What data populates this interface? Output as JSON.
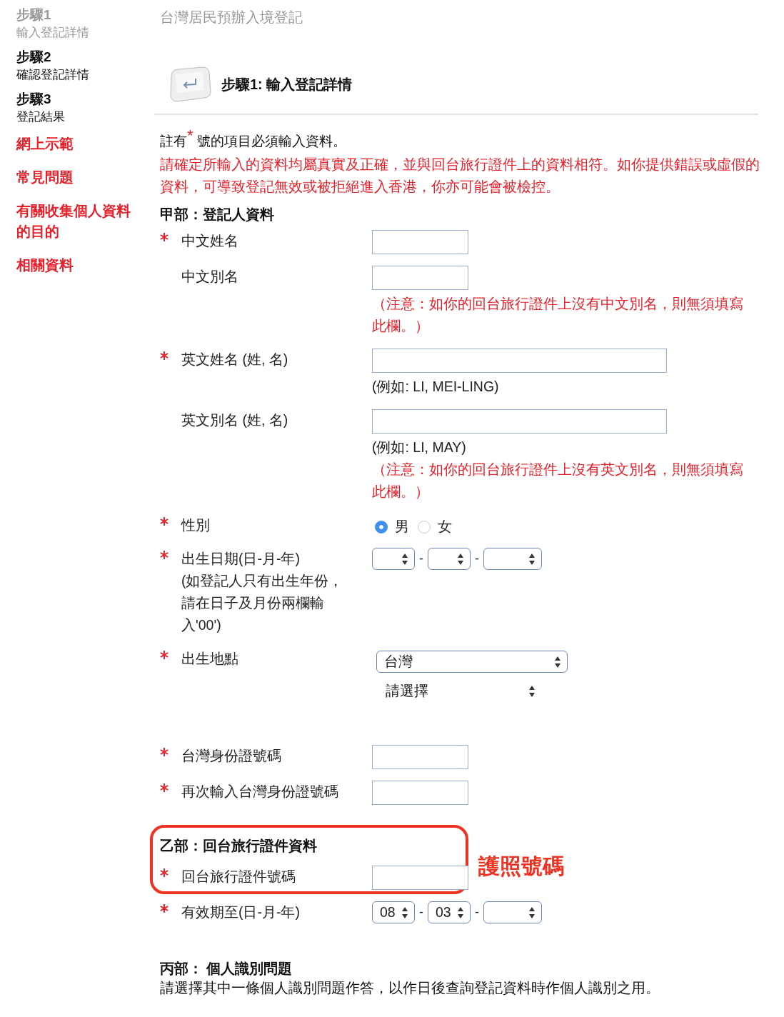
{
  "sidebar": {
    "steps": [
      {
        "step": "步驟1",
        "label": "輸入登記詳情",
        "disabled": true
      },
      {
        "step": "步驟2",
        "label": "確認登記詳情",
        "disabled": false
      },
      {
        "step": "步驟3",
        "label": "登記結果",
        "disabled": false
      }
    ],
    "links": [
      "網上示範",
      "常見問題",
      "有關收集個人資料的目的",
      "相關資料"
    ]
  },
  "page_title": "台灣居民預辦入境登記",
  "step_heading": "步驟1: 輸入登記詳情",
  "required_note": "註有$^{*}$ 號的項目必須輸入資料。",
  "warning": "請確定所輸入的資料均屬真實及正確，並與回台旅行證件上的資料相符。如你提供錯誤或虛假的資料，可導致登記無效或被拒絕進入香港，你亦可能會被檢控。",
  "sections": [
    {
      "heading": "甲部：登記人資料",
      "fields": [
        {
          "kind": "text",
          "label": "中文姓名",
          "required": true,
          "wide": false
        },
        {
          "kind": "text",
          "label": "中文別名",
          "required": false,
          "wide": false,
          "note": "（注意：如你的回台旅行證件上沒有中文別名，則無須填寫此欄。）"
        },
        {
          "kind": "text",
          "label": "英文姓名 (姓, 名)",
          "required": true,
          "wide": true,
          "hint": "(例如: LI, MEI-LING)"
        },
        {
          "kind": "text",
          "label": "英文別名 (姓, 名)",
          "required": false,
          "wide": true,
          "hint": "(例如: LI, MAY)",
          "note": "（注意：如你的回台旅行證件上沒有英文別名，則無須填寫此欄。）"
        },
        {
          "kind": "radio",
          "label": "性別",
          "required": true,
          "options": [
            {
              "label": "男",
              "selected": true
            },
            {
              "label": "女",
              "selected": false
            }
          ]
        },
        {
          "kind": "date",
          "label": "出生日期(日-月-年)",
          "sublabel": "(如登記人只有出生年份，請在日子及月份兩欄輸入'00')",
          "required": true,
          "separators": [
            "-",
            "-"
          ]
        },
        {
          "kind": "place",
          "label": "出生地點",
          "required": true,
          "value": "台灣",
          "placeholder": "請選擇"
        },
        {
          "kind": "text",
          "label": "台灣身份證號碼",
          "required": true,
          "wide": false
        },
        {
          "kind": "text",
          "label": "再次輸入台灣身份證號碼",
          "required": true,
          "wide": false
        }
      ]
    },
    {
      "heading": "乙部：回台旅行證件資料",
      "callout": "護照號碼",
      "fields": [
        {
          "kind": "text",
          "label": "回台旅行證件號碼",
          "required": true,
          "wide": false,
          "highlighted": true
        },
        {
          "kind": "date",
          "label": "有效期至(日-月-年)",
          "required": true,
          "values": [
            "08",
            "03"
          ],
          "separators": [
            "-",
            "-"
          ],
          "highlighted": false
        }
      ]
    },
    {
      "heading": "丙部： 個人識別問題",
      "text": "請選擇其中一條個人識別問題作答，以作日後查詢登記資料時作個人識別之用。"
    }
  ]
}
